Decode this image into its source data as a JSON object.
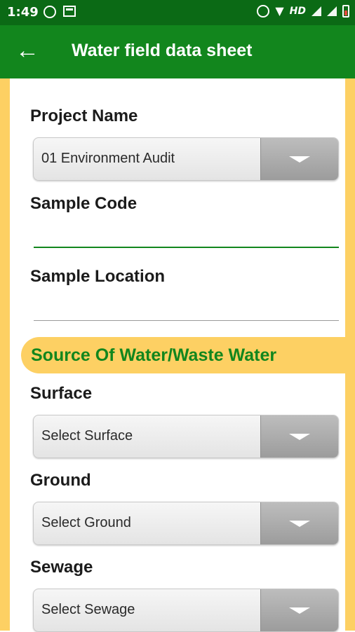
{
  "status_bar": {
    "time": "1:49",
    "network": "HD"
  },
  "app_bar": {
    "title": "Water field data sheet"
  },
  "form": {
    "project_name_label": "Project Name",
    "project_name_value": "01 Environment Audit",
    "sample_code_label": "Sample Code",
    "sample_location_label": "Sample Location",
    "section_title": "Source Of Water/Waste Water",
    "surface_label": "Surface",
    "surface_value": "Select Surface",
    "ground_label": "Ground",
    "ground_value": "Select Ground",
    "sewage_label": "Sewage",
    "sewage_value": "Select Sewage"
  },
  "colors": {
    "status_bar": "#0b6a15",
    "app_bar": "#12861d",
    "accent_yellow": "#fdd063",
    "section_text": "#12861d"
  },
  "icons": {
    "back": "arrow-left-icon",
    "dropdown": "chevron-down-icon",
    "whatsapp": "whatsapp-icon",
    "calendar": "calendar-icon",
    "alarm": "alarm-icon",
    "wifi": "wifi-icon",
    "signal": "signal-icon",
    "battery": "battery-icon"
  }
}
